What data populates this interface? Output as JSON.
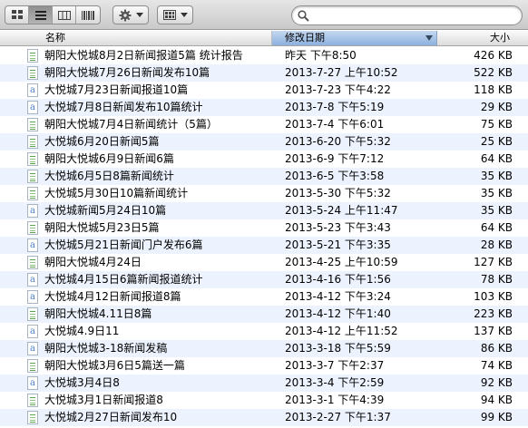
{
  "toolbar": {
    "view_buttons": [
      "icon-view",
      "list-view",
      "column-view",
      "coverflow-view"
    ],
    "active_view": "list-view",
    "action_icon": "gear-icon",
    "arrange_icon": "arrange-grid-icon",
    "search": {
      "value": "",
      "placeholder": ""
    }
  },
  "columns": {
    "name": "名称",
    "date": "修改日期",
    "size": "大小"
  },
  "files": [
    {
      "name": "朝阳大悦城8月2日新闻报道5篇 统计报告",
      "date": "昨天 下午8:50",
      "size": "426 KB",
      "icon": "green"
    },
    {
      "name": "朝阳大悦城7月26日新闻发布10篇",
      "date": "2013-7-27 上午10:52",
      "size": "522 KB",
      "icon": "green"
    },
    {
      "name": "大悦城7月23日新闻报道10篇",
      "date": "2013-7-23 下午4:22",
      "size": "118 KB",
      "icon": "blue"
    },
    {
      "name": "大悦城7月8日新闻发布10篇统计",
      "date": "2013-7-8 下午5:19",
      "size": "29 KB",
      "icon": "blue"
    },
    {
      "name": "朝阳大悦城7月4日新闻统计（5篇）",
      "date": "2013-7-4 下午6:01",
      "size": "75 KB",
      "icon": "green"
    },
    {
      "name": "大悦城6月20日新闻5篇",
      "date": "2013-6-20 下午5:32",
      "size": "25 KB",
      "icon": "green"
    },
    {
      "name": "朝阳大悦城6月9日新闻6篇",
      "date": "2013-6-9 下午7:12",
      "size": "64 KB",
      "icon": "green"
    },
    {
      "name": "大悦城6月5日8篇新闻统计",
      "date": "2013-6-5 下午3:58",
      "size": "35 KB",
      "icon": "green"
    },
    {
      "name": "大悦城5月30日10篇新闻统计",
      "date": "2013-5-30 下午5:32",
      "size": "35 KB",
      "icon": "green"
    },
    {
      "name": "大悦城新闻5月24日10篇",
      "date": "2013-5-24 上午11:47",
      "size": "35 KB",
      "icon": "blue"
    },
    {
      "name": "朝阳大悦城5月23日5篇",
      "date": "2013-5-23 下午3:43",
      "size": "64 KB",
      "icon": "green"
    },
    {
      "name": "大悦城5月21日新闻门户发布6篇",
      "date": "2013-5-21 下午3:35",
      "size": "28 KB",
      "icon": "blue"
    },
    {
      "name": "朝阳大悦城4月24日",
      "date": "2013-4-25 上午10:59",
      "size": "127 KB",
      "icon": "green"
    },
    {
      "name": "大悦城4月15日6篇新闻报道统计",
      "date": "2013-4-16 下午1:56",
      "size": "78 KB",
      "icon": "blue"
    },
    {
      "name": "大悦城4月12日新闻报道8篇",
      "date": "2013-4-12 下午3:24",
      "size": "103 KB",
      "icon": "blue"
    },
    {
      "name": "朝阳大悦城4.11日8篇",
      "date": "2013-4-12 下午1:40",
      "size": "223 KB",
      "icon": "green"
    },
    {
      "name": "大悦城4.9日11",
      "date": "2013-4-12 上午11:52",
      "size": "137 KB",
      "icon": "blue"
    },
    {
      "name": "朝阳大悦城3-18新闻发稿",
      "date": "2013-3-18 下午5:59",
      "size": "86 KB",
      "icon": "blue"
    },
    {
      "name": "朝阳大悦城3月6日5篇送一篇",
      "date": "2013-3-7 下午2:37",
      "size": "74 KB",
      "icon": "green"
    },
    {
      "name": "大悦城3月4日8",
      "date": "2013-3-4 下午2:59",
      "size": "92 KB",
      "icon": "blue"
    },
    {
      "name": "大悦城3月1日新闻报道8",
      "date": "2013-3-1 下午4:39",
      "size": "94 KB",
      "icon": "green"
    },
    {
      "name": "大悦城2月27日新闻发布10",
      "date": "2013-2-27 下午1:37",
      "size": "99 KB",
      "icon": "green"
    }
  ]
}
